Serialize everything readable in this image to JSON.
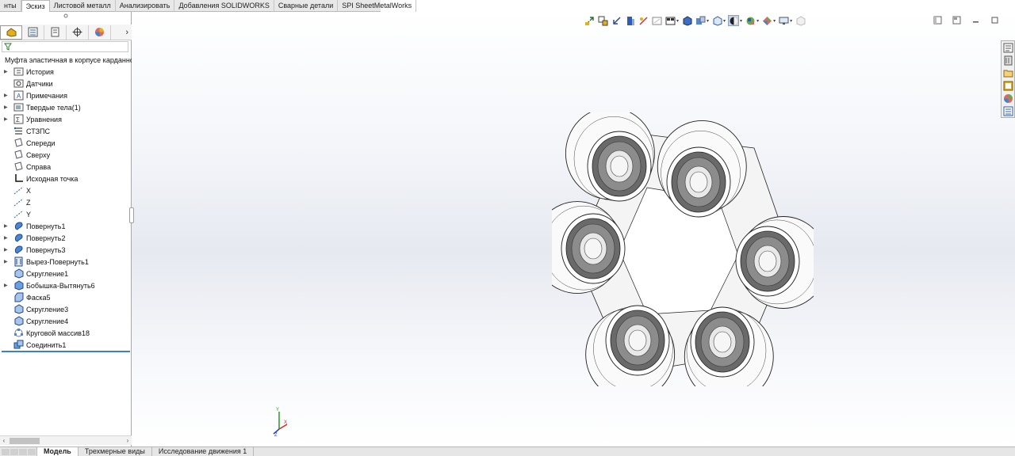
{
  "command_tabs": [
    {
      "label": "нты",
      "active": false
    },
    {
      "label": "Эскиз",
      "active": true
    },
    {
      "label": "Листовой металл",
      "active": false
    },
    {
      "label": "Анализировать",
      "active": false
    },
    {
      "label": "Добавления SOLIDWORKS",
      "active": false
    },
    {
      "label": "Сварные детали",
      "active": false
    },
    {
      "label": "SPI SheetMetalWorks",
      "active": false
    }
  ],
  "feature_tree": {
    "root": "Муфта эластичная в корпусе карданного вала",
    "items": [
      {
        "label": "История",
        "icon": "history-folder-icon",
        "expandable": true
      },
      {
        "label": "Датчики",
        "icon": "sensors-icon",
        "expandable": false
      },
      {
        "label": "Примечания",
        "icon": "annotations-icon",
        "expandable": true
      },
      {
        "label": "Твердые тела(1)",
        "icon": "solid-bodies-icon",
        "expandable": true
      },
      {
        "label": "Уравнения",
        "icon": "equations-icon",
        "expandable": true
      },
      {
        "label": "СТЗПС",
        "icon": "material-icon",
        "expandable": false
      },
      {
        "label": "Спереди",
        "icon": "plane-icon",
        "expandable": false
      },
      {
        "label": "Сверху",
        "icon": "plane-icon",
        "expandable": false
      },
      {
        "label": "Справа",
        "icon": "plane-icon",
        "expandable": false
      },
      {
        "label": "Исходная точка",
        "icon": "origin-icon",
        "expandable": false
      },
      {
        "label": "X",
        "icon": "axis-icon",
        "expandable": false
      },
      {
        "label": "Z",
        "icon": "axis-icon",
        "expandable": false
      },
      {
        "label": "Y",
        "icon": "axis-icon",
        "expandable": false
      },
      {
        "label": "Повернуть1",
        "icon": "revolve-icon",
        "expandable": true
      },
      {
        "label": "Повернуть2",
        "icon": "revolve-icon",
        "expandable": true
      },
      {
        "label": "Повернуть3",
        "icon": "revolve-icon",
        "expandable": true
      },
      {
        "label": "Вырез-Повернуть1",
        "icon": "revolve-cut-icon",
        "expandable": true
      },
      {
        "label": "Скругление1",
        "icon": "fillet-icon",
        "expandable": false
      },
      {
        "label": "Бобышка-Вытянуть6",
        "icon": "extrude-icon",
        "expandable": true
      },
      {
        "label": "Фаска5",
        "icon": "chamfer-icon",
        "expandable": false
      },
      {
        "label": "Скругление3",
        "icon": "fillet-icon",
        "expandable": false
      },
      {
        "label": "Скругление4",
        "icon": "fillet-icon",
        "expandable": false
      },
      {
        "label": "Круговой массив18",
        "icon": "circular-pattern-icon",
        "expandable": false
      },
      {
        "label": "Соединить1",
        "icon": "combine-icon",
        "expandable": false
      }
    ]
  },
  "bottom_tabs": [
    {
      "label": "Модель",
      "active": true
    },
    {
      "label": "Трехмерные виды",
      "active": false
    },
    {
      "label": "Исследование движения 1",
      "active": false
    }
  ],
  "triad": {
    "axes": [
      "Y",
      "X",
      "Z"
    ]
  },
  "colors": {
    "accent_blue": "#3a82c8",
    "model_face": "#f7f7f7",
    "model_edge": "#2a2a2a",
    "rubber_dark": "#5a5a5a"
  }
}
